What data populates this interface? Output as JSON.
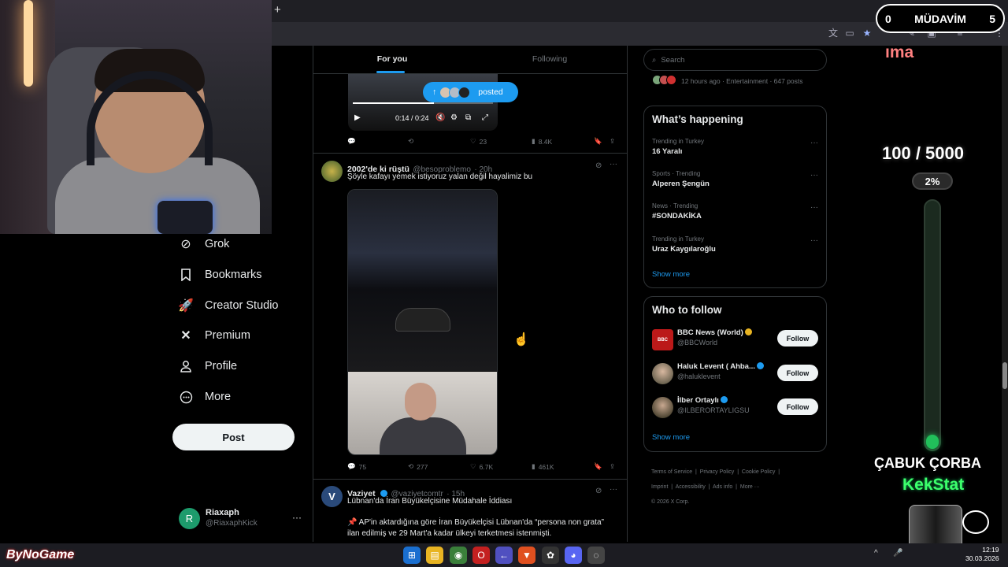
{
  "browser": {
    "new_tab_label": "+"
  },
  "nav": {
    "items": [
      {
        "label": "Grok",
        "icon": "grok-icon"
      },
      {
        "label": "Bookmarks",
        "icon": "bookmark-icon"
      },
      {
        "label": "Creator Studio",
        "icon": "rocket-icon"
      },
      {
        "label": "Premium",
        "icon": "x-logo-icon"
      },
      {
        "label": "Profile",
        "icon": "person-icon"
      },
      {
        "label": "More",
        "icon": "more-circle-icon"
      }
    ],
    "post_label": "Post",
    "account": {
      "initial": "R",
      "name": "Riaxaph",
      "handle": "@RiaxaphKick",
      "more": "···"
    }
  },
  "feed": {
    "tabs": [
      "For you",
      "Following"
    ],
    "video1": {
      "time": "0:14 / 0:24",
      "progress": 0.58,
      "posted_label": "posted"
    },
    "tweet1_actions": {
      "replies": "",
      "retweets": "",
      "likes": "23",
      "views": "8.4K"
    },
    "tweet2": {
      "name": "2002'de ki rüştü",
      "handle": "@besoproblemo",
      "time": "· 20h",
      "text": "Şöyle kafayı yemek istiyoruz yalan değil hayalimiz bu",
      "replies": "75",
      "retweets": "277",
      "likes": "6.7K",
      "views": "461K"
    },
    "tweet3": {
      "name": "Vaziyet",
      "handle": "@vaziyetcomtr",
      "time": "· 15h",
      "line1": "Lübnan'da İran Büyükelçisine Müdahale İddiası",
      "line2": "📌 AP'in aktardığına göre  İran Büyükelçisi Lübnan'da “persona non grata”",
      "line3": "ilan edilmiş ve 29 Mart'a kadar ülkeyi terketmesi istenmişti."
    }
  },
  "sidebar": {
    "search_placeholder": "Search",
    "entertainment_line": "12 hours ago · Entertainment · 647 posts",
    "happening_title": "What’s happening",
    "trends": [
      {
        "context": "Trending in Turkey",
        "name": "16 Yaralı"
      },
      {
        "context": "Sports · Trending",
        "name": "Alperen Şengün"
      },
      {
        "context": "News · Trending",
        "name": "#SONDAKİKA"
      },
      {
        "context": "Trending in Turkey",
        "name": "Uraz Kaygılaroğlu"
      }
    ],
    "show_more": "Show more",
    "who_title": "Who to follow",
    "follow_label": "Follow",
    "accounts": [
      {
        "name": "BBC News (World)",
        "handle": "@BBCWorld",
        "badge": "#e8b422"
      },
      {
        "name": "Haluk Levent ( Ahba...",
        "handle": "@haluklevent",
        "badge": "#1d9bf0"
      },
      {
        "name": "İlber Ortaylı",
        "handle": "@ILBERORTAYLIGSU",
        "badge": "#1d9bf0"
      }
    ],
    "footer": [
      "Terms of Service",
      "Privacy Policy",
      "Cookie Policy",
      "Imprint",
      "Accessibility",
      "Ads info",
      "More ···",
      "© 2026 X Corp."
    ]
  },
  "overlay": {
    "mudavim_left": "0",
    "mudavim_label": "MÜDAVİM",
    "mudavim_right": "5",
    "ima": "ıma",
    "goal": "100 / 5000",
    "goal_pct": "2%",
    "goal_fraction": 0.02,
    "cabuk": "ÇABUK ÇORBA",
    "kekstat": "KekStat",
    "bynogame": "ByNoGame"
  },
  "taskbar": {
    "time": "12:19",
    "date": "30.03.2026"
  },
  "colors": {
    "accent": "#1d9bf0",
    "bg": "#000000",
    "goal_green": "#21c05a"
  }
}
